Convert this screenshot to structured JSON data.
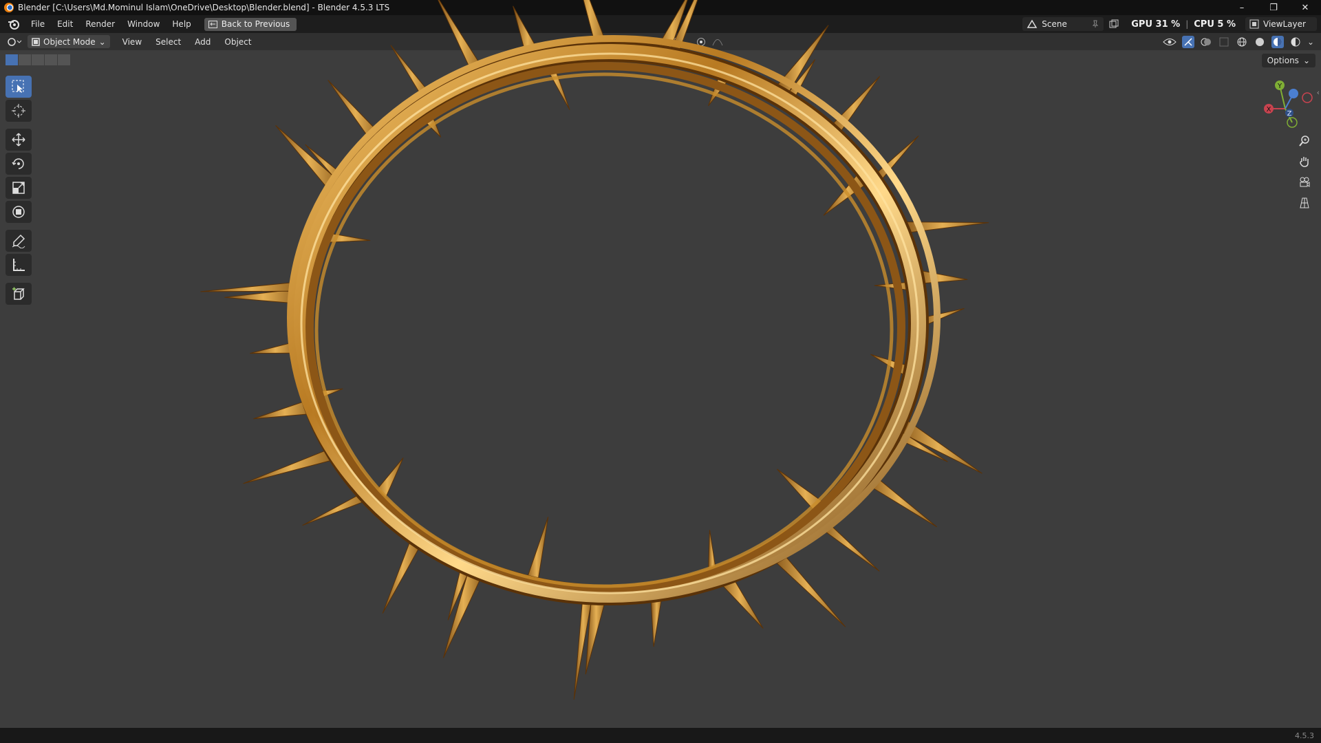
{
  "window": {
    "title": "Blender [C:\\Users\\Md.Mominul Islam\\OneDrive\\Desktop\\Blender.blend] - Blender 4.5.3 LTS",
    "controls": {
      "minimize": "–",
      "restore": "❐",
      "close": "✕"
    }
  },
  "menu": {
    "items": [
      "File",
      "Edit",
      "Render",
      "Window",
      "Help"
    ],
    "back_button": "Back to Previous",
    "scene": "Scene",
    "view_layer": "ViewLayer",
    "gpu": "GPU 31 %",
    "cpu": "CPU 5 %"
  },
  "viewport_header": {
    "mode": "Object Mode",
    "menus": [
      "View",
      "Select",
      "Add",
      "Object"
    ],
    "transform_orientation": "Global"
  },
  "viewport": {
    "options_label": "Options",
    "gizmo": {
      "x": "X",
      "y": "Y",
      "z": "Z"
    },
    "tools": [
      "select-box",
      "cursor",
      "move",
      "rotate",
      "scale",
      "transform",
      "annotate",
      "measure",
      "add-cube"
    ]
  },
  "status": {
    "version": "4.5.3"
  },
  "colors": {
    "accent": "#4772b3",
    "crown_gold": "#c98d2c",
    "background": "#3d3d3d"
  }
}
